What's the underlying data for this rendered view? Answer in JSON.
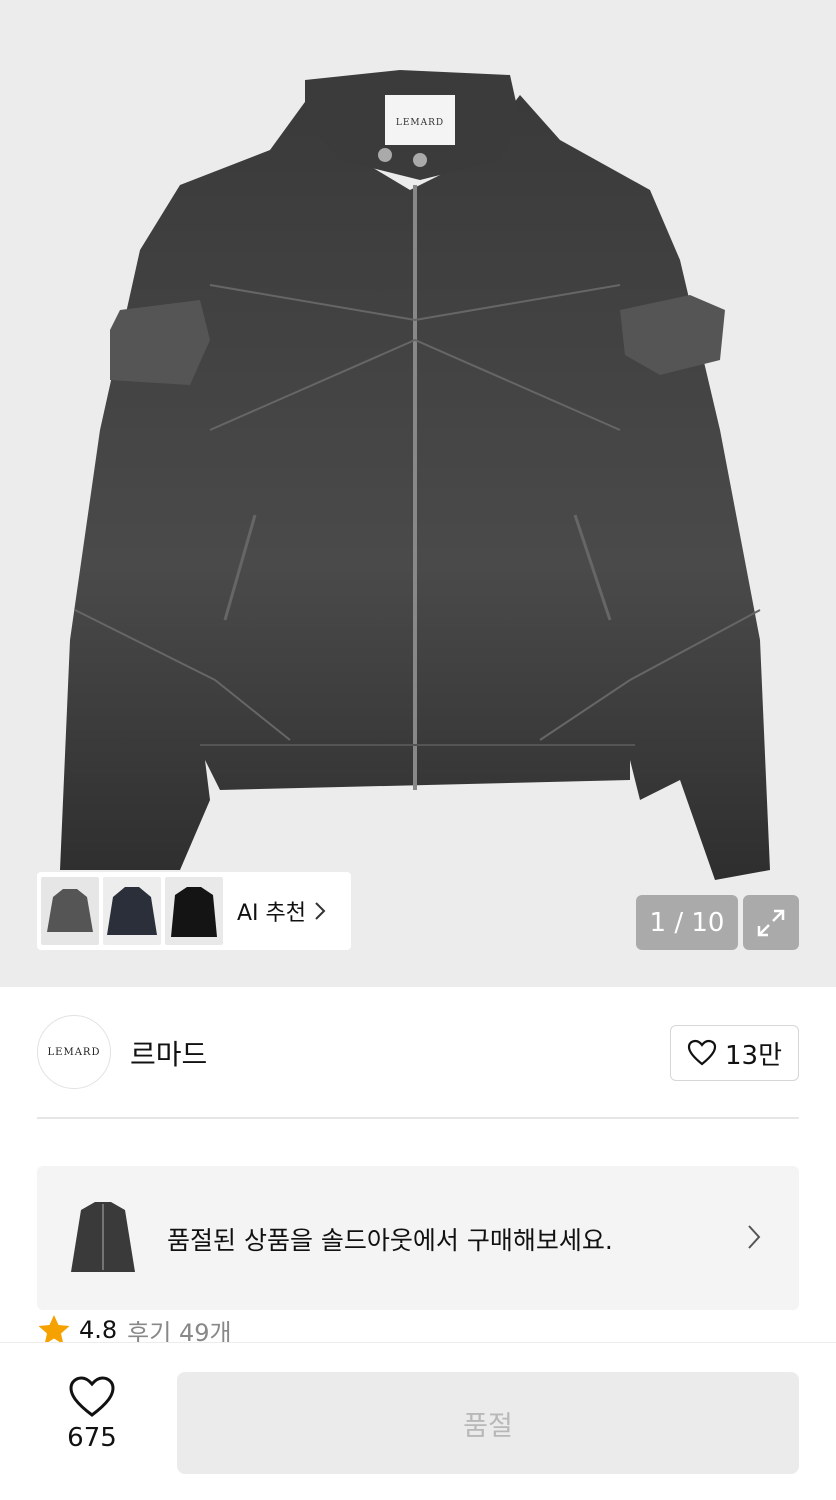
{
  "hero": {
    "tag_text": "LEMARD",
    "ai_recommend_label": "AI 추천",
    "page_indicator": "1 / 10"
  },
  "brand": {
    "logo_text": "LEMARD",
    "name": "르마드",
    "like_count": "13만"
  },
  "soldout_banner": {
    "message": "품절된 상품을 솔드아웃에서 구매해보세요."
  },
  "rating": {
    "score": "4.8",
    "review_label": "후기 49개"
  },
  "bottom": {
    "wish_count": "675",
    "purchase_label": "품절"
  },
  "colors": {
    "star": "#f5a200",
    "hero_bg": "#ececec",
    "buy_btn_bg": "#ebebeb"
  },
  "icons": [
    "heart-icon",
    "star-icon",
    "chevron-right-icon",
    "expand-icon"
  ]
}
